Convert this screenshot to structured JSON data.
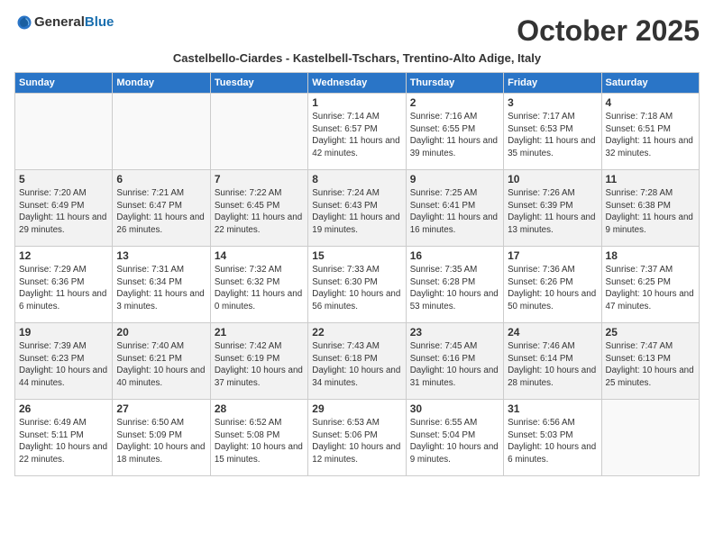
{
  "logo": {
    "general": "General",
    "blue": "Blue"
  },
  "title": "October 2025",
  "subtitle": "Castelbello-Ciardes - Kastelbell-Tschars, Trentino-Alto Adige, Italy",
  "days_of_week": [
    "Sunday",
    "Monday",
    "Tuesday",
    "Wednesday",
    "Thursday",
    "Friday",
    "Saturday"
  ],
  "weeks": [
    [
      {
        "day": "",
        "info": ""
      },
      {
        "day": "",
        "info": ""
      },
      {
        "day": "",
        "info": ""
      },
      {
        "day": "1",
        "info": "Sunrise: 7:14 AM\nSunset: 6:57 PM\nDaylight: 11 hours and 42 minutes."
      },
      {
        "day": "2",
        "info": "Sunrise: 7:16 AM\nSunset: 6:55 PM\nDaylight: 11 hours and 39 minutes."
      },
      {
        "day": "3",
        "info": "Sunrise: 7:17 AM\nSunset: 6:53 PM\nDaylight: 11 hours and 35 minutes."
      },
      {
        "day": "4",
        "info": "Sunrise: 7:18 AM\nSunset: 6:51 PM\nDaylight: 11 hours and 32 minutes."
      }
    ],
    [
      {
        "day": "5",
        "info": "Sunrise: 7:20 AM\nSunset: 6:49 PM\nDaylight: 11 hours and 29 minutes."
      },
      {
        "day": "6",
        "info": "Sunrise: 7:21 AM\nSunset: 6:47 PM\nDaylight: 11 hours and 26 minutes."
      },
      {
        "day": "7",
        "info": "Sunrise: 7:22 AM\nSunset: 6:45 PM\nDaylight: 11 hours and 22 minutes."
      },
      {
        "day": "8",
        "info": "Sunrise: 7:24 AM\nSunset: 6:43 PM\nDaylight: 11 hours and 19 minutes."
      },
      {
        "day": "9",
        "info": "Sunrise: 7:25 AM\nSunset: 6:41 PM\nDaylight: 11 hours and 16 minutes."
      },
      {
        "day": "10",
        "info": "Sunrise: 7:26 AM\nSunset: 6:39 PM\nDaylight: 11 hours and 13 minutes."
      },
      {
        "day": "11",
        "info": "Sunrise: 7:28 AM\nSunset: 6:38 PM\nDaylight: 11 hours and 9 minutes."
      }
    ],
    [
      {
        "day": "12",
        "info": "Sunrise: 7:29 AM\nSunset: 6:36 PM\nDaylight: 11 hours and 6 minutes."
      },
      {
        "day": "13",
        "info": "Sunrise: 7:31 AM\nSunset: 6:34 PM\nDaylight: 11 hours and 3 minutes."
      },
      {
        "day": "14",
        "info": "Sunrise: 7:32 AM\nSunset: 6:32 PM\nDaylight: 11 hours and 0 minutes."
      },
      {
        "day": "15",
        "info": "Sunrise: 7:33 AM\nSunset: 6:30 PM\nDaylight: 10 hours and 56 minutes."
      },
      {
        "day": "16",
        "info": "Sunrise: 7:35 AM\nSunset: 6:28 PM\nDaylight: 10 hours and 53 minutes."
      },
      {
        "day": "17",
        "info": "Sunrise: 7:36 AM\nSunset: 6:26 PM\nDaylight: 10 hours and 50 minutes."
      },
      {
        "day": "18",
        "info": "Sunrise: 7:37 AM\nSunset: 6:25 PM\nDaylight: 10 hours and 47 minutes."
      }
    ],
    [
      {
        "day": "19",
        "info": "Sunrise: 7:39 AM\nSunset: 6:23 PM\nDaylight: 10 hours and 44 minutes."
      },
      {
        "day": "20",
        "info": "Sunrise: 7:40 AM\nSunset: 6:21 PM\nDaylight: 10 hours and 40 minutes."
      },
      {
        "day": "21",
        "info": "Sunrise: 7:42 AM\nSunset: 6:19 PM\nDaylight: 10 hours and 37 minutes."
      },
      {
        "day": "22",
        "info": "Sunrise: 7:43 AM\nSunset: 6:18 PM\nDaylight: 10 hours and 34 minutes."
      },
      {
        "day": "23",
        "info": "Sunrise: 7:45 AM\nSunset: 6:16 PM\nDaylight: 10 hours and 31 minutes."
      },
      {
        "day": "24",
        "info": "Sunrise: 7:46 AM\nSunset: 6:14 PM\nDaylight: 10 hours and 28 minutes."
      },
      {
        "day": "25",
        "info": "Sunrise: 7:47 AM\nSunset: 6:13 PM\nDaylight: 10 hours and 25 minutes."
      }
    ],
    [
      {
        "day": "26",
        "info": "Sunrise: 6:49 AM\nSunset: 5:11 PM\nDaylight: 10 hours and 22 minutes."
      },
      {
        "day": "27",
        "info": "Sunrise: 6:50 AM\nSunset: 5:09 PM\nDaylight: 10 hours and 18 minutes."
      },
      {
        "day": "28",
        "info": "Sunrise: 6:52 AM\nSunset: 5:08 PM\nDaylight: 10 hours and 15 minutes."
      },
      {
        "day": "29",
        "info": "Sunrise: 6:53 AM\nSunset: 5:06 PM\nDaylight: 10 hours and 12 minutes."
      },
      {
        "day": "30",
        "info": "Sunrise: 6:55 AM\nSunset: 5:04 PM\nDaylight: 10 hours and 9 minutes."
      },
      {
        "day": "31",
        "info": "Sunrise: 6:56 AM\nSunset: 5:03 PM\nDaylight: 10 hours and 6 minutes."
      },
      {
        "day": "",
        "info": ""
      }
    ]
  ]
}
